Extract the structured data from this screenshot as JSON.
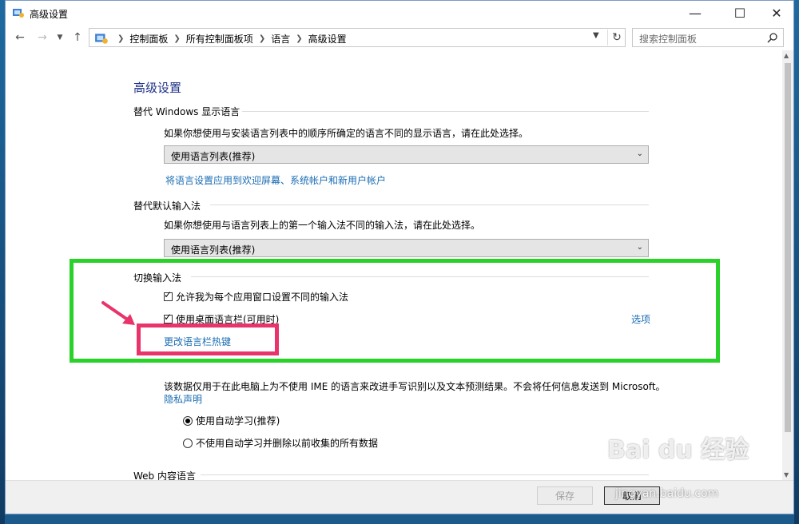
{
  "window": {
    "title": "高级设置"
  },
  "nav": {
    "breadcrumbs": [
      "控制面板",
      "所有控制面板项",
      "语言",
      "高级设置"
    ],
    "search_placeholder": "搜索控制面板"
  },
  "page": {
    "title": "高级设置",
    "display_language": {
      "heading": "替代 Windows 显示语言",
      "description": "如果你想使用与安装语言列表中的顺序所确定的语言不同的显示语言，请在此处选择。",
      "select_value": "使用语言列表(推荐)",
      "apply_link": "将语言设置应用到欢迎屏幕、系统帐户和新用户帐户"
    },
    "default_input": {
      "heading": "替代默认输入法",
      "description": "如果你想使用与语言列表上的第一个输入法不同的输入法，请在此处选择。",
      "select_value": "使用语言列表(推荐)"
    },
    "switch_input": {
      "heading": "切换输入法",
      "checkbox1": "允许我为每个应用窗口设置不同的输入法",
      "checkbox2": "使用桌面语言栏(可用时)",
      "options_link": "选项",
      "hotkey_link": "更改语言栏热键"
    },
    "personalization": {
      "description": "该数据仅用于在此电脑上为不使用 IME 的语言来改进手写识别以及文本预测结果。不会将任何信息发送到 Microsoft。",
      "privacy_link": "隐私声明",
      "radio1": "使用自动学习(推荐)",
      "radio2": "不使用自动学习并删除以前收集的所有数据"
    },
    "web_content": {
      "heading": "Web 内容语言"
    }
  },
  "footer": {
    "save_label": "保存",
    "cancel_label": "取消"
  },
  "watermark": {
    "text": "Bai du 经验",
    "sub": "jingyan.baidu.com"
  },
  "colors": {
    "highlight_green": "#2ad12a",
    "highlight_pink": "#e8336b",
    "link_blue": "#1a6cb3",
    "title_blue": "#1e3287"
  }
}
